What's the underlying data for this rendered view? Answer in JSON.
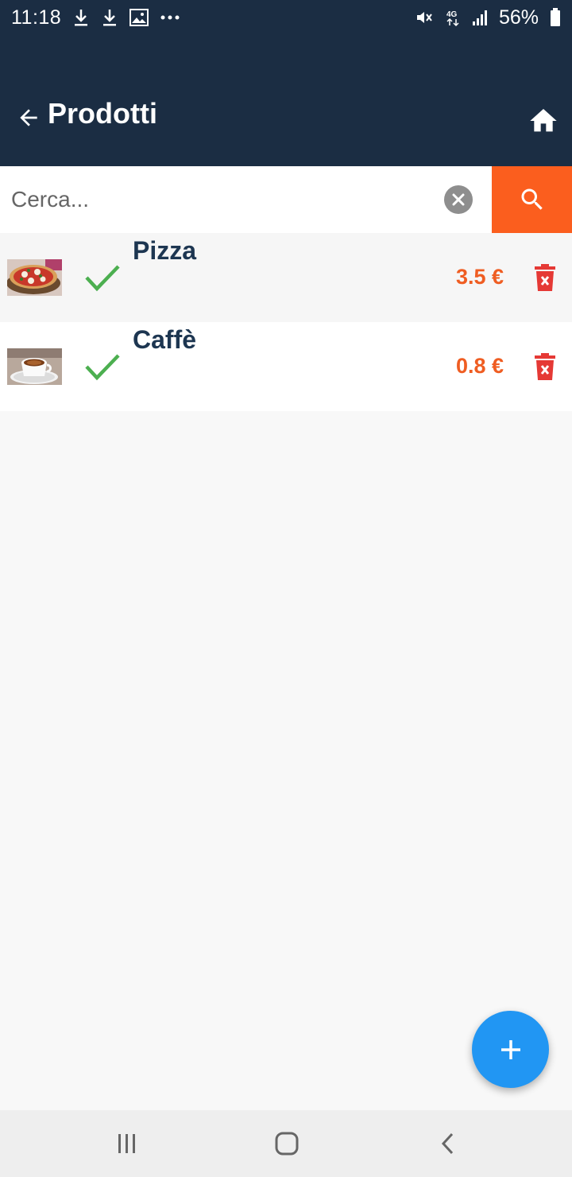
{
  "status_bar": {
    "time": "11:18",
    "battery": "56%",
    "network": "4G",
    "icons": [
      "download-icon",
      "download-icon",
      "image-icon",
      "more-dots-icon",
      "mute-icon",
      "signal-icon",
      "battery-icon"
    ]
  },
  "app_bar": {
    "title": "Prodotti",
    "icons": {
      "back": "arrow-back-icon",
      "home": "home-icon"
    }
  },
  "search": {
    "placeholder": "Cerca...",
    "value": "",
    "icons": {
      "clear": "clear-icon",
      "search": "search-icon"
    }
  },
  "products": [
    {
      "name": "Pizza",
      "price": "3.5 €",
      "image": "pizza-image",
      "active": true
    },
    {
      "name": "Caffè",
      "price": "0.8 €",
      "image": "coffee-image",
      "active": true
    }
  ],
  "fab": {
    "icon": "plus-icon"
  },
  "nav_bar": {
    "icons": [
      "recent-apps-icon",
      "home-nav-icon",
      "back-nav-icon"
    ]
  },
  "colors": {
    "app_bar": "#1b2d43",
    "accent_orange": "#fb5e1e",
    "price": "#ef5d22",
    "check": "#4caf50",
    "delete": "#e53935",
    "fab": "#2196f3",
    "product_name": "#1d3651"
  }
}
